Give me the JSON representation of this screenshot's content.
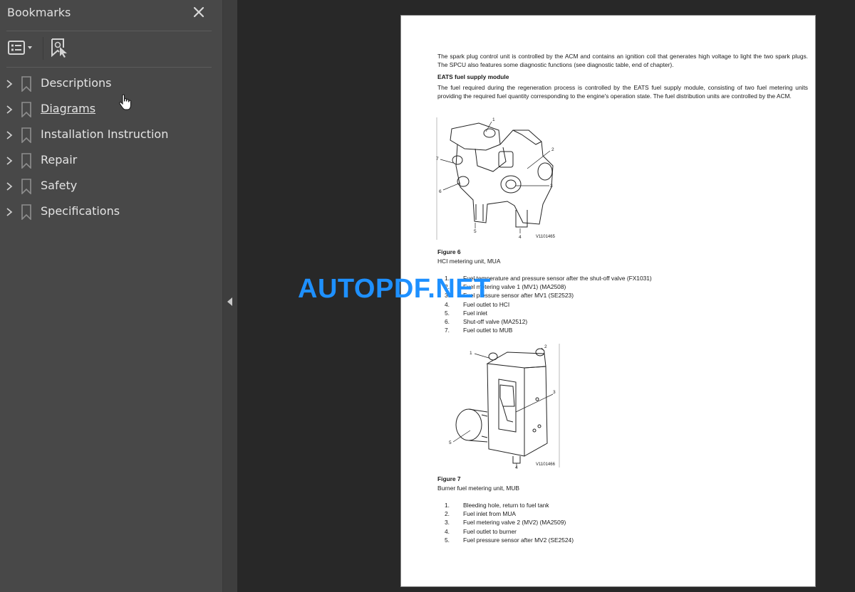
{
  "sidebar": {
    "title": "Bookmarks",
    "toolbar": {
      "options_icon": "list-options-icon",
      "find_icon": "find-bookmark-icon"
    },
    "items": [
      {
        "label": "Descriptions",
        "underlined": false
      },
      {
        "label": "Diagrams",
        "underlined": true
      },
      {
        "label": "Installation Instruction",
        "underlined": false
      },
      {
        "label": "Repair",
        "underlined": false
      },
      {
        "label": "Safety",
        "underlined": false
      },
      {
        "label": "Specifications",
        "underlined": false
      }
    ]
  },
  "document": {
    "intro_paragraph": "The spark plug control unit is controlled by the ACM and contains an ignition coil that generates high voltage to light the two spark plugs. The SPCU also features some diagnostic functions (see diagnostic table, end of chapter).",
    "section_heading": "EATS fuel supply module",
    "section_paragraph": "The fuel required during the regeneration process is controlled by the EATS fuel supply module, consisting of two fuel metering units providing the required fuel quantity corresponding to the engine's operation state. The fuel distribution units are controlled by the ACM.",
    "figure6": {
      "image_ref": "V1101465",
      "callouts": [
        "1",
        "2",
        "3",
        "4",
        "5",
        "6",
        "7"
      ],
      "title": "Figure 6",
      "caption": "HCI metering unit, MUA",
      "items": [
        {
          "num": "1.",
          "text": "Fuel temperature and pressure sensor after the shut-off valve (FX1031)"
        },
        {
          "num": "2.",
          "text": "Fuel metering valve 1 (MV1) (MA2508)"
        },
        {
          "num": "3.",
          "text": "Fuel pressure sensor after MV1 (SE2523)"
        },
        {
          "num": "4.",
          "text": "Fuel outlet to HCI"
        },
        {
          "num": "5.",
          "text": "Fuel inlet"
        },
        {
          "num": "6.",
          "text": "Shut-off valve (MA2512)"
        },
        {
          "num": "7.",
          "text": "Fuel outlet to MUB"
        }
      ]
    },
    "figure7": {
      "image_ref": "V1101466",
      "callouts": [
        "1",
        "2",
        "3",
        "4",
        "5"
      ],
      "title": "Figure 7",
      "caption": "Burner fuel metering unit, MUB",
      "items": [
        {
          "num": "1.",
          "text": "Bleeding hole, return to fuel tank"
        },
        {
          "num": "2.",
          "text": "Fuel inlet from MUA"
        },
        {
          "num": "3.",
          "text": "Fuel metering valve 2 (MV2) (MA2509)"
        },
        {
          "num": "4.",
          "text": "Fuel outlet to burner"
        },
        {
          "num": "5.",
          "text": "Fuel pressure sensor after MV2 (SE2524)"
        }
      ]
    }
  },
  "watermark": {
    "text": "AUTOPDF.NET",
    "color": "#1e90ff"
  },
  "colors": {
    "sidebar_bg": "#484848",
    "viewer_bg": "#282828",
    "page_bg": "#ffffff"
  }
}
